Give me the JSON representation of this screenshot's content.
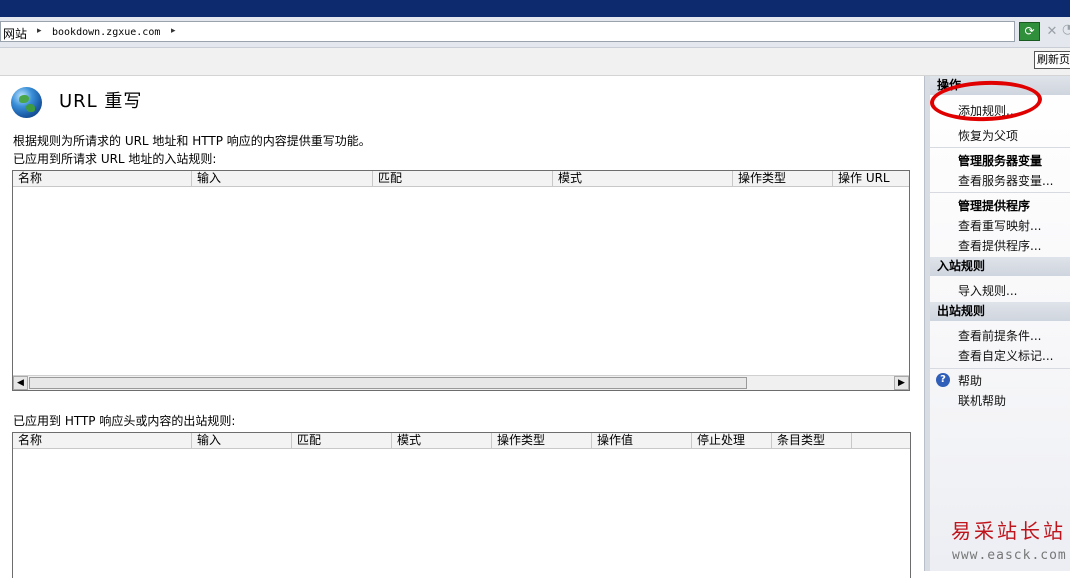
{
  "address_bar": {
    "crumbs": [
      "网站",
      "bookdown.zgxue.com"
    ],
    "separator": "▸",
    "refresh_icon": "refresh-icon",
    "stop_icon": "stop-icon",
    "stop_glyph": "✕"
  },
  "toolbar": {
    "refresh_page_label": "刷新页"
  },
  "main": {
    "title": "URL 重写",
    "description": "根据规则为所请求的 URL 地址和 HTTP 响应的内容提供重写功能。",
    "inbound": {
      "label": "已应用到所请求 URL 地址的入站规则:",
      "columns": [
        "名称",
        "输入",
        "匹配",
        "模式",
        "操作类型",
        "操作 URL"
      ]
    },
    "outbound": {
      "label": "已应用到 HTTP 响应头或内容的出站规则:",
      "columns": [
        "名称",
        "输入",
        "匹配",
        "模式",
        "操作类型",
        "操作值",
        "停止处理",
        "条目类型"
      ]
    },
    "scroll_left": "◀",
    "scroll_right": "▶"
  },
  "actions": {
    "header": "操作",
    "add_rule": "添加规则...",
    "revert_parent": "恢复为父项",
    "manage_server_vars": "管理服务器变量",
    "view_server_vars": "查看服务器变量...",
    "manage_providers": "管理提供程序",
    "view_rewrite_maps": "查看重写映射...",
    "view_providers": "查看提供程序...",
    "inbound_rules": "入站规则",
    "import_rules": "导入规则...",
    "outbound_rules": "出站规则",
    "view_preconditions": "查看前提条件...",
    "view_custom_tags": "查看自定义标记...",
    "help_glyph": "?",
    "help": "帮助",
    "online_help": "联机帮助"
  },
  "watermark": {
    "brand": "易采站长站",
    "url": "www.easck.com"
  },
  "colors": {
    "title_bar": "#0e2a6e",
    "highlight_circle": "#e00000",
    "watermark_red": "#c0141c"
  }
}
